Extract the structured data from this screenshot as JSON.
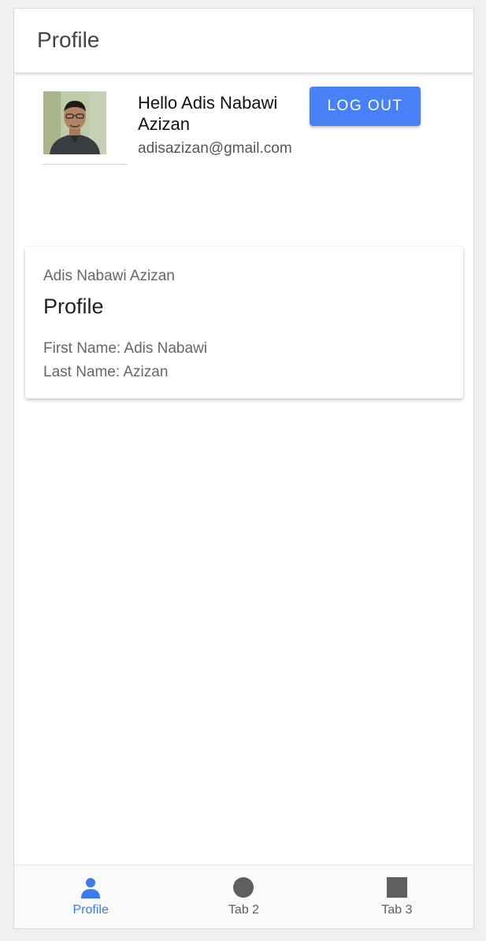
{
  "header": {
    "title": "Profile"
  },
  "user": {
    "avatar_icon": "user-photo",
    "greeting": "Hello Adis Nabawi Azizan",
    "email": "adisazizan@gmail.com",
    "logout_label": "LOG OUT"
  },
  "card": {
    "subtitle": "Adis Nabawi Azizan",
    "title": "Profile",
    "first_name_line": "First Name: Adis Nabawi",
    "last_name_line": "Last Name: Azizan"
  },
  "tabs": [
    {
      "label": "Profile",
      "icon": "person-icon",
      "active": true
    },
    {
      "label": "Tab 2",
      "icon": "circle-icon",
      "active": false
    },
    {
      "label": "Tab 3",
      "icon": "square-icon",
      "active": false
    }
  ],
  "colors": {
    "accent": "#4a80f5",
    "tab_active": "#3b7bec",
    "tab_inactive": "#5f5f5f"
  }
}
